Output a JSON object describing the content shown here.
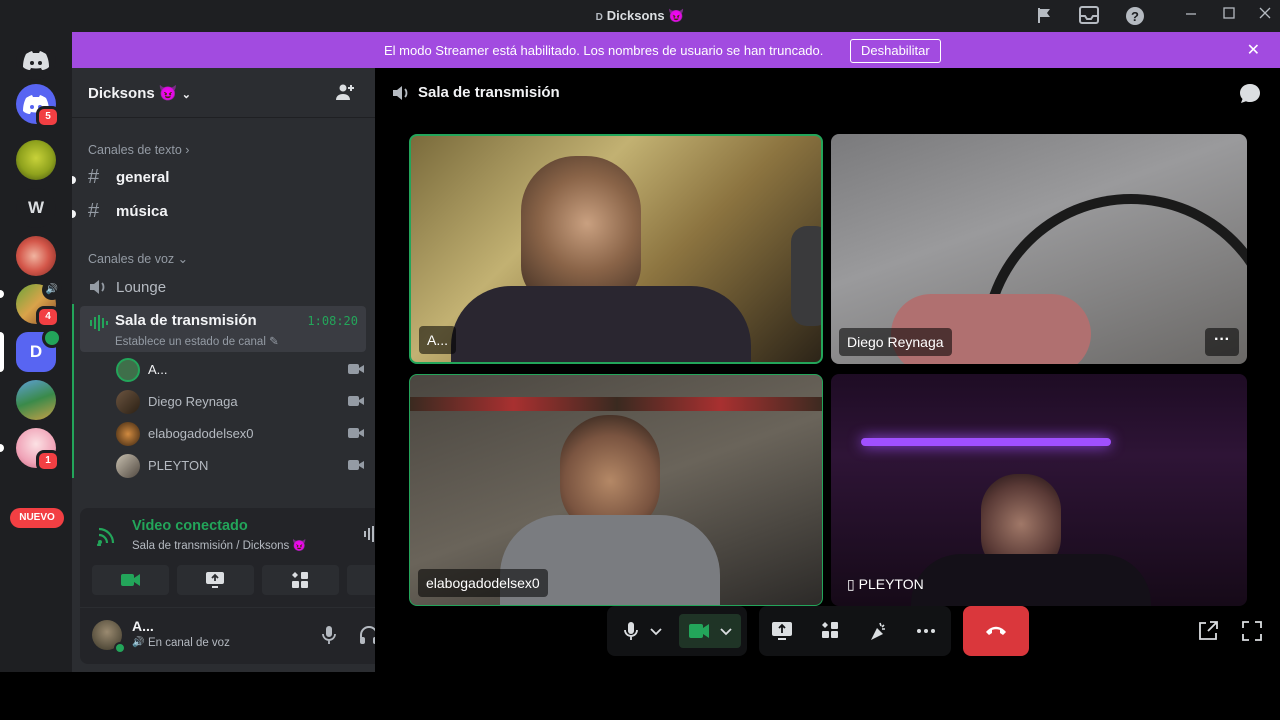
{
  "window": {
    "title": "Dicksons",
    "title_tiny": "D",
    "title_emoji": "😈"
  },
  "rail": {
    "badges": {
      "home": "5",
      "guild_mic": "4",
      "guild_kids": "1"
    },
    "letter_guild": "W",
    "new_label": "NUEVO"
  },
  "banner": {
    "text": "El modo Streamer está habilitado. Los nombres de usuario se han truncado.",
    "button": "Deshabilitar",
    "close": "✕"
  },
  "sidebar": {
    "guild_name": "Dicksons",
    "guild_emoji": "😈",
    "text_category": "Canales de texto",
    "text_channels": [
      "general",
      "música"
    ],
    "voice_category": "Canales de voz",
    "voice_channels": {
      "lounge": "Lounge",
      "active": "Sala de transmisión",
      "active_timer": "1:08:20",
      "active_status": "Establece un estado de canal"
    },
    "voice_users": [
      "A...",
      "Diego Reynaga",
      "elabogadodelsex0",
      "PLEYTON"
    ]
  },
  "voice_panel": {
    "title": "Video conectado",
    "subtitle": "Sala de transmisión / Dicksons 😈"
  },
  "user_area": {
    "name": "A...",
    "status": "En canal de voz"
  },
  "main": {
    "channel_title": "Sala de transmisión",
    "tiles": [
      {
        "label": "A..."
      },
      {
        "label": "Diego Reynaga",
        "more": "···"
      },
      {
        "label": "elabogadodelsex0"
      },
      {
        "label": "PLEYTON"
      }
    ]
  },
  "colors": {
    "accent_green": "#23a55a",
    "banner_purple": "#a24be0",
    "danger_red": "#da373c",
    "badge_red": "#f23f43"
  }
}
